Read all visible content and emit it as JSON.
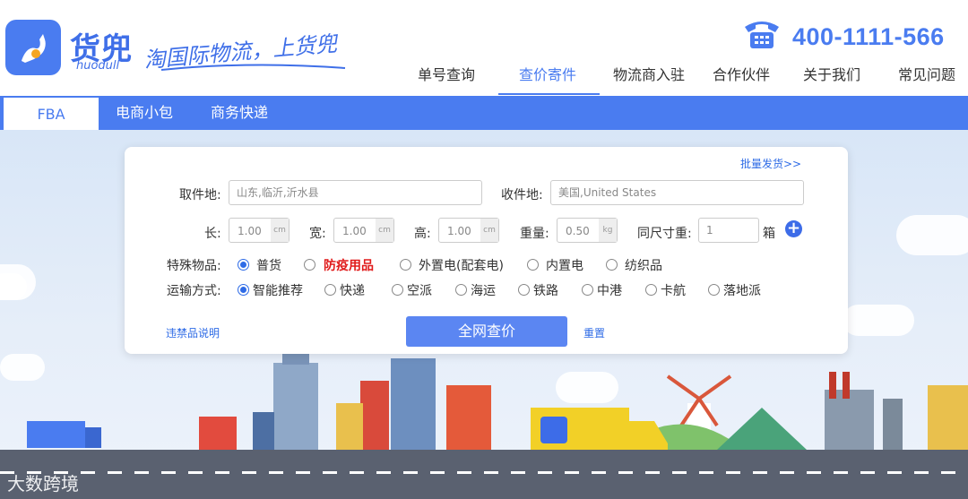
{
  "brand": {
    "logo_cn": "货兜",
    "logo_en": "huodull",
    "slogan": "淘国际物流，上货兜",
    "phone": "400-1111-566"
  },
  "nav": {
    "items": [
      "单号查询",
      "查价寄件",
      "物流商入驻",
      "合作伙伴",
      "关于我们",
      "常见问题"
    ],
    "active": "查价寄件"
  },
  "tabs": [
    "FBA",
    "电商小包",
    "商务快递"
  ],
  "form": {
    "batch_link": "批量发货>>",
    "pickup_label": "取件地:",
    "pickup_value": "山东,临沂,沂水县",
    "receive_label": "收件地:",
    "receive_value": "美国,United States",
    "length_label": "长:",
    "width_label": "宽:",
    "height_label": "高:",
    "weight_label": "重量:",
    "length_value": "1.00",
    "width_value": "1.00",
    "height_value": "1.00",
    "weight_value": "0.50",
    "unit_cm": "cm",
    "unit_kg": "kg",
    "same_size_label": "同尺寸重:",
    "same_size_value": "1",
    "box_unit": "箱",
    "special_label": "特殊物品:",
    "special_options": [
      "普货",
      "防疫用品",
      "外置电(配套电)",
      "内置电",
      "纺织品"
    ],
    "transport_label": "运输方式:",
    "transport_options": [
      "智能推荐",
      "快递",
      "空派",
      "海运",
      "铁路",
      "中港",
      "卡航",
      "落地派"
    ],
    "prohibited_link": "违禁品说明",
    "search_button": "全网查价",
    "reset_link": "重置"
  },
  "watermark": "大数跨境",
  "colors": {
    "accent": "#4a7cf0",
    "button": "#5b86f2",
    "danger": "#e01b1b"
  }
}
